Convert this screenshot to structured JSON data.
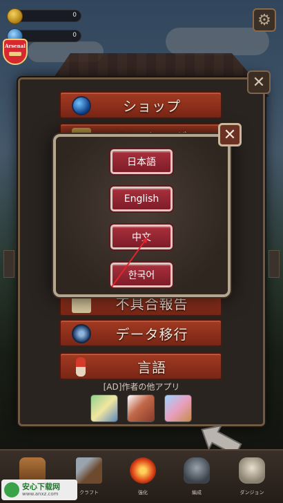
{
  "hud": {
    "gold_value": "0",
    "gem_value": "0",
    "badge_text": "Arsenal"
  },
  "menu": {
    "items": [
      {
        "label": "ショップ",
        "icon": "orb-icon"
      },
      {
        "label": "ランキング",
        "icon": "ranking-icon"
      },
      {
        "label": "不具合報告",
        "icon": "report-icon"
      },
      {
        "label": "データ移行",
        "icon": "transfer-icon"
      },
      {
        "label": "言語",
        "icon": "language-icon"
      }
    ],
    "ad_label": "[AD]作者の他アプリ"
  },
  "language_dialog": {
    "close_glyph": "✕",
    "options": [
      "日本語",
      "English",
      "中文",
      "한국어"
    ],
    "highlighted": "中文"
  },
  "bottom_nav": {
    "tabs": [
      {
        "label": "",
        "icon": "chest-icon"
      },
      {
        "label": "クラフト",
        "icon": "hammer-icon"
      },
      {
        "label": "強化",
        "icon": "fire-icon"
      },
      {
        "label": "編成",
        "icon": "helmet-icon"
      },
      {
        "label": "ダンジョン",
        "icon": "skull-icon"
      }
    ]
  },
  "watermark": {
    "title": "安心下载网",
    "url": "www.anxz.com"
  },
  "colors": {
    "menu_button": "#8e3020",
    "language_button": "#9a2834",
    "dialog_border": "#b7a68f",
    "pointer": "#e0252e"
  }
}
